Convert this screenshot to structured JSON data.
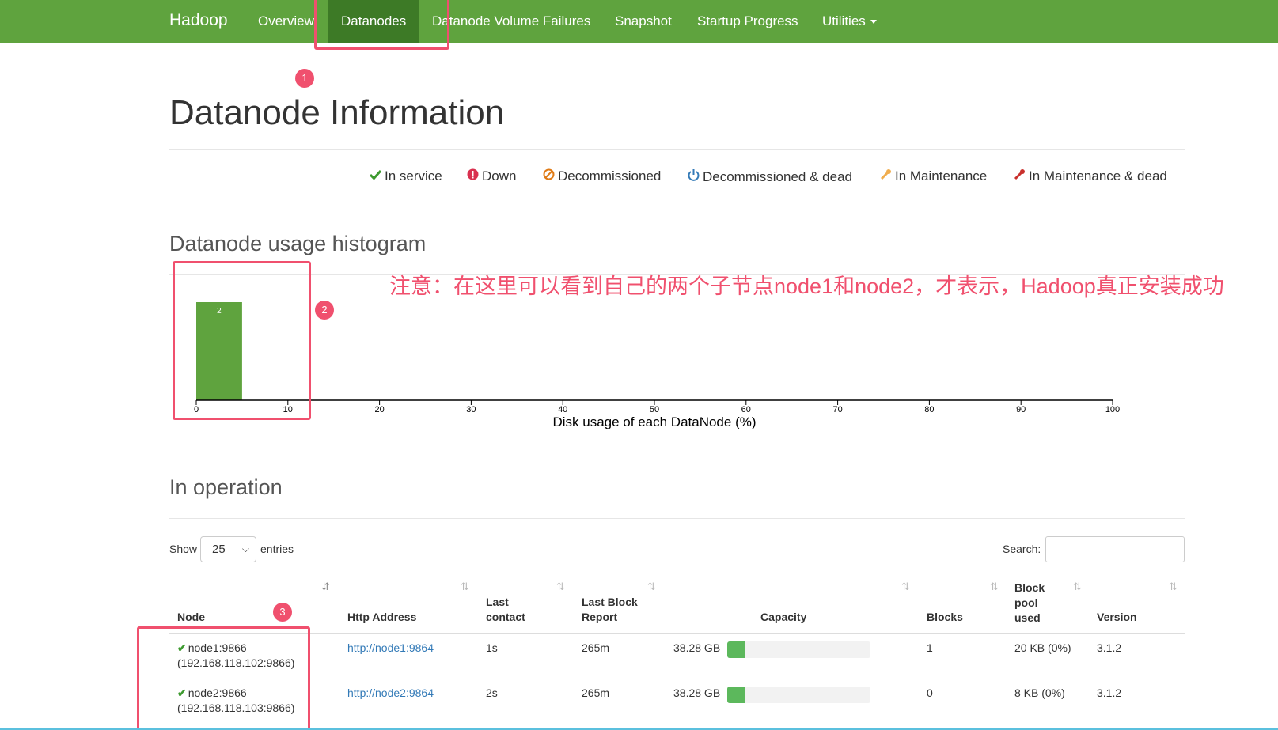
{
  "navbar": {
    "brand": "Hadoop",
    "items": [
      {
        "label": "Overview"
      },
      {
        "label": "Datanodes"
      },
      {
        "label": "Datanode Volume Failures"
      },
      {
        "label": "Snapshot"
      },
      {
        "label": "Startup Progress"
      },
      {
        "label": "Utilities"
      }
    ],
    "active_color": "#3d7a26",
    "bar_color": "#5fa33e"
  },
  "annotations": {
    "markers": [
      "1",
      "2",
      "3"
    ],
    "note": "注意：在这里可以看到自己的两个子节点node1和node2，才表示，Hadoop真正安装成功",
    "color": "#f0506e"
  },
  "page": {
    "title": "Datanode Information"
  },
  "legend": [
    {
      "icon": "check-icon",
      "label": "In service",
      "color": "#3d9a2f"
    },
    {
      "icon": "exclamation-circle-icon",
      "label": "Down",
      "color": "#d9304f"
    },
    {
      "icon": "ban-icon",
      "label": "Decommissioned",
      "color": "#e07b16"
    },
    {
      "icon": "power-icon",
      "label": "Decommissioned & dead",
      "color": "#337ab7"
    },
    {
      "icon": "wrench-icon",
      "label": "In Maintenance",
      "color": "#f0ad4e"
    },
    {
      "icon": "wrench-icon",
      "label": "In Maintenance & dead",
      "color": "#c9302c"
    }
  ],
  "histogram": {
    "heading": "Datanode usage histogram"
  },
  "chart_data": {
    "type": "bar",
    "title": "",
    "xlabel": "Disk usage of each DataNode (%)",
    "ylabel": "",
    "xlim": [
      0,
      100
    ],
    "xticks": [
      "0",
      "10",
      "20",
      "30",
      "40",
      "50",
      "60",
      "70",
      "80",
      "90",
      "100"
    ],
    "bins": [
      {
        "x_start": 0,
        "x_end": 5,
        "count": 2
      }
    ],
    "bar_color": "#5fa33e"
  },
  "operation": {
    "heading": "In operation",
    "show_label": "Show",
    "entries_value": "25",
    "entries_label": "entries",
    "search_label": "Search:",
    "search_value": "",
    "columns": {
      "node": "Node",
      "http": "Http Address",
      "last_contact_1": "Last",
      "last_contact_2": "contact",
      "last_block_1": "Last Block",
      "last_block_2": "Report",
      "capacity": "Capacity",
      "blocks": "Blocks",
      "pool_1": "Block",
      "pool_2": "pool",
      "pool_3": "used",
      "version": "Version"
    },
    "rows": [
      {
        "node": "node1:9866",
        "ip": "(192.168.118.102:9866)",
        "http": "http://node1:9864",
        "last_contact": "1s",
        "last_block_report": "265m",
        "capacity": "38.28 GB",
        "usage_fraction": 0.12,
        "blocks": "1",
        "pool_used": "20 KB (0%)",
        "version": "3.1.2"
      },
      {
        "node": "node2:9866",
        "ip": "(192.168.118.103:9866)",
        "http": "http://node2:9864",
        "last_contact": "2s",
        "last_block_report": "265m",
        "capacity": "38.28 GB",
        "usage_fraction": 0.12,
        "blocks": "0",
        "pool_used": "8 KB (0%)",
        "version": "3.1.2"
      }
    ]
  }
}
